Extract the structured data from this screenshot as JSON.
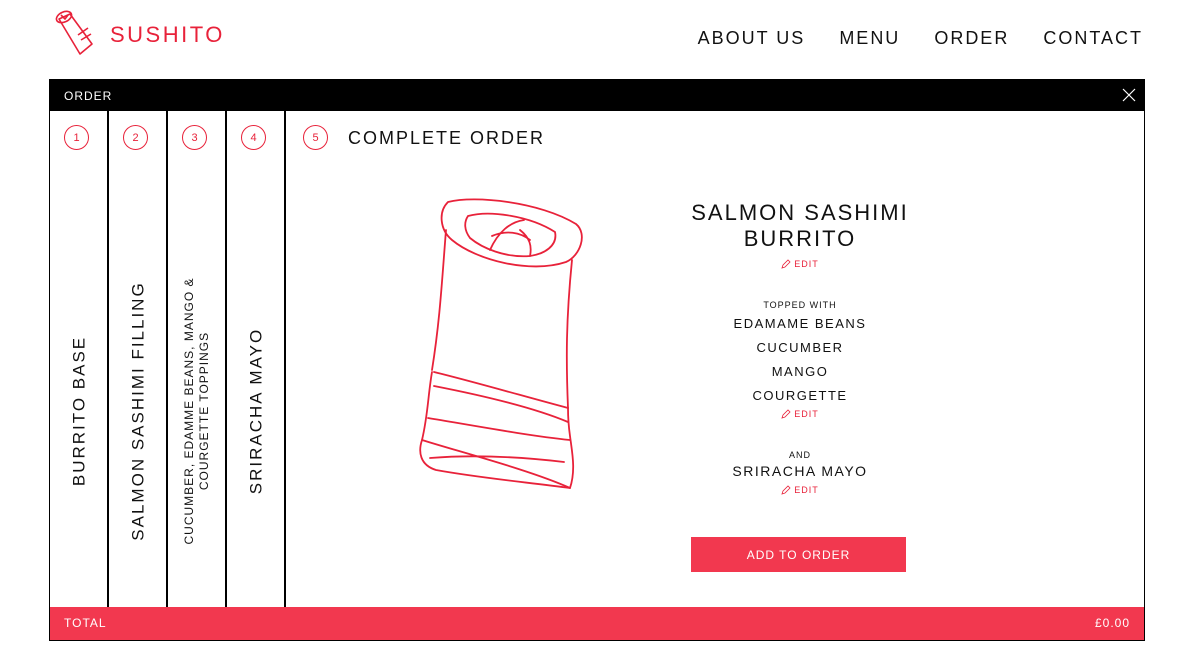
{
  "brand": {
    "name": "SUSHITO",
    "icon": "sushi-roll-logo-icon",
    "accent_color": "#e8223a"
  },
  "nav": {
    "items": [
      "ABOUT US",
      "MENU",
      "ORDER",
      "CONTACT"
    ]
  },
  "order_panel": {
    "title": "ORDER",
    "close_icon": "close-icon",
    "steps": [
      {
        "number": "1",
        "label": "BURRITO BASE"
      },
      {
        "number": "2",
        "label": "SALMON SASHIMI FILLING"
      },
      {
        "number": "3",
        "label_line1": "CUCUMBER, EDAMME BEANS, MANGO &",
        "label_line2": "COURGETTE TOPPINGS"
      },
      {
        "number": "4",
        "label": "SRIRACHA MAYO"
      },
      {
        "number": "5",
        "label": "COMPLETE ORDER"
      }
    ]
  },
  "summary": {
    "product_line1": "SALMON SASHIMI",
    "product_line2": "BURRITO",
    "edit_label": "EDIT",
    "topped_with_label": "TOPPED WITH",
    "toppings": [
      "EDAMAME BEANS",
      "CUCUMBER",
      "MANGO",
      "COURGETTE"
    ],
    "and_label": "AND",
    "sauce": "SRIRACHA MAYO",
    "add_button": "ADD TO ORDER"
  },
  "total": {
    "label": "TOTAL",
    "amount": "£0.00",
    "bar_color": "#f2384f"
  }
}
